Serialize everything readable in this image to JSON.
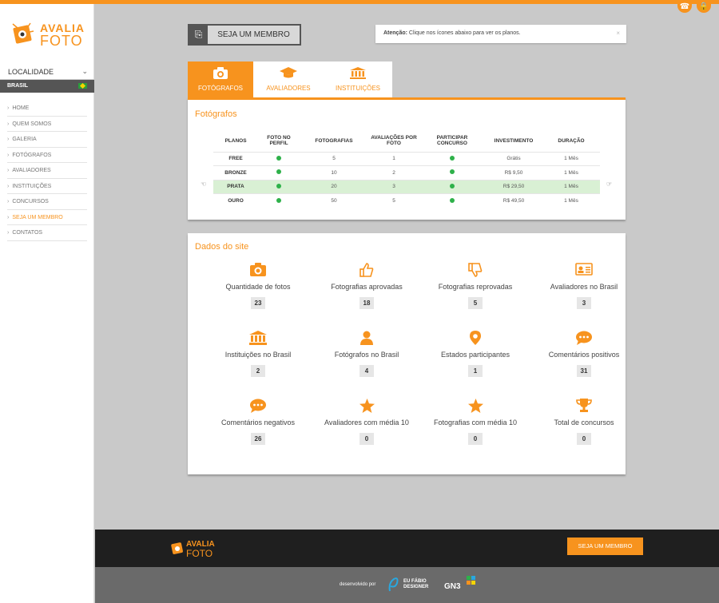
{
  "brand": {
    "line1": "AVALIA",
    "line2": "FOTO",
    "color": "#f7931e"
  },
  "top_icons": [
    "phone-icon",
    "lock-icon"
  ],
  "sidebar": {
    "location_label": "LOCALIDADE",
    "location_value": "BRASIL",
    "menu": [
      "HOME",
      "QUEM SOMOS",
      "GALERIA",
      "FOTÓGRAFOS",
      "AVALIADORES",
      "INSTITUIÇÕES",
      "CONCURSOS",
      "SEJA UM MEMBRO",
      "CONTATOS"
    ],
    "active_item": "SEJA UM MEMBRO"
  },
  "header": {
    "member_button": "SEJA UM MEMBRO",
    "notice_bold": "Atenção:",
    "notice_text": " Clique nos ícones abaixo para ver os planos.",
    "notice_close": "×"
  },
  "tabs": [
    {
      "label": "FOTÓGRAFOS",
      "icon": "camera-icon",
      "active": true
    },
    {
      "label": "AVALIADORES",
      "icon": "graduation-cap-icon",
      "active": false
    },
    {
      "label": "INSTITUIÇÕES",
      "icon": "institution-icon",
      "active": false
    }
  ],
  "plans": {
    "title": "Fotógrafos",
    "columns": [
      "PLANOS",
      "FOTO NO PERFIL",
      "FOTOGRAFIAS",
      "AVALIAÇÕES POR FOTO",
      "PARTICIPAR CONCURSO",
      "INVESTIMENTO",
      "DURAÇÃO"
    ],
    "rows": [
      {
        "plan": "FREE",
        "photo": true,
        "photos": "5",
        "evals": "1",
        "contest": true,
        "price": "Grátis",
        "duration": "1 Mês"
      },
      {
        "plan": "BRONZE",
        "photo": true,
        "photos": "10",
        "evals": "2",
        "contest": true,
        "price": "R$ 9,50",
        "duration": "1 Mês"
      },
      {
        "plan": "PRATA",
        "photo": true,
        "photos": "20",
        "evals": "3",
        "contest": true,
        "price": "R$ 29,50",
        "duration": "1 Mês",
        "highlight": true
      },
      {
        "plan": "OURO",
        "photo": true,
        "photos": "50",
        "evals": "5",
        "contest": true,
        "price": "R$ 49,50",
        "duration": "1 Mês"
      }
    ]
  },
  "stats": {
    "title": "Dados do site",
    "items": [
      {
        "label": "Quantidade de fotos",
        "value": "23",
        "icon": "camera-icon"
      },
      {
        "label": "Fotografias aprovadas",
        "value": "18",
        "icon": "thumbs-up-icon"
      },
      {
        "label": "Fotografias reprovadas",
        "value": "5",
        "icon": "thumbs-down-icon"
      },
      {
        "label": "Avaliadores no Brasil",
        "value": "3",
        "icon": "id-card-icon"
      },
      {
        "label": "Instituições no Brasil",
        "value": "2",
        "icon": "institution-icon"
      },
      {
        "label": "Fotógrafos no Brasil",
        "value": "4",
        "icon": "user-icon"
      },
      {
        "label": "Estados participantes",
        "value": "1",
        "icon": "map-pin-icon"
      },
      {
        "label": "Comentários positivos",
        "value": "31",
        "icon": "comment-icon"
      },
      {
        "label": "Comentários negativos",
        "value": "26",
        "icon": "comment-icon"
      },
      {
        "label": "Avaliadores com média 10",
        "value": "0",
        "icon": "star-icon"
      },
      {
        "label": "Fotografias com média 10",
        "value": "0",
        "icon": "star-icon"
      },
      {
        "label": "Total de concursos",
        "value": "0",
        "icon": "trophy-icon"
      }
    ]
  },
  "footer": {
    "member_button": "SEJA UM MEMBRO",
    "developed_by": "desenvolvido por",
    "partner1": "EU FÁBIO DESIGNER",
    "partner2": "GN3"
  }
}
